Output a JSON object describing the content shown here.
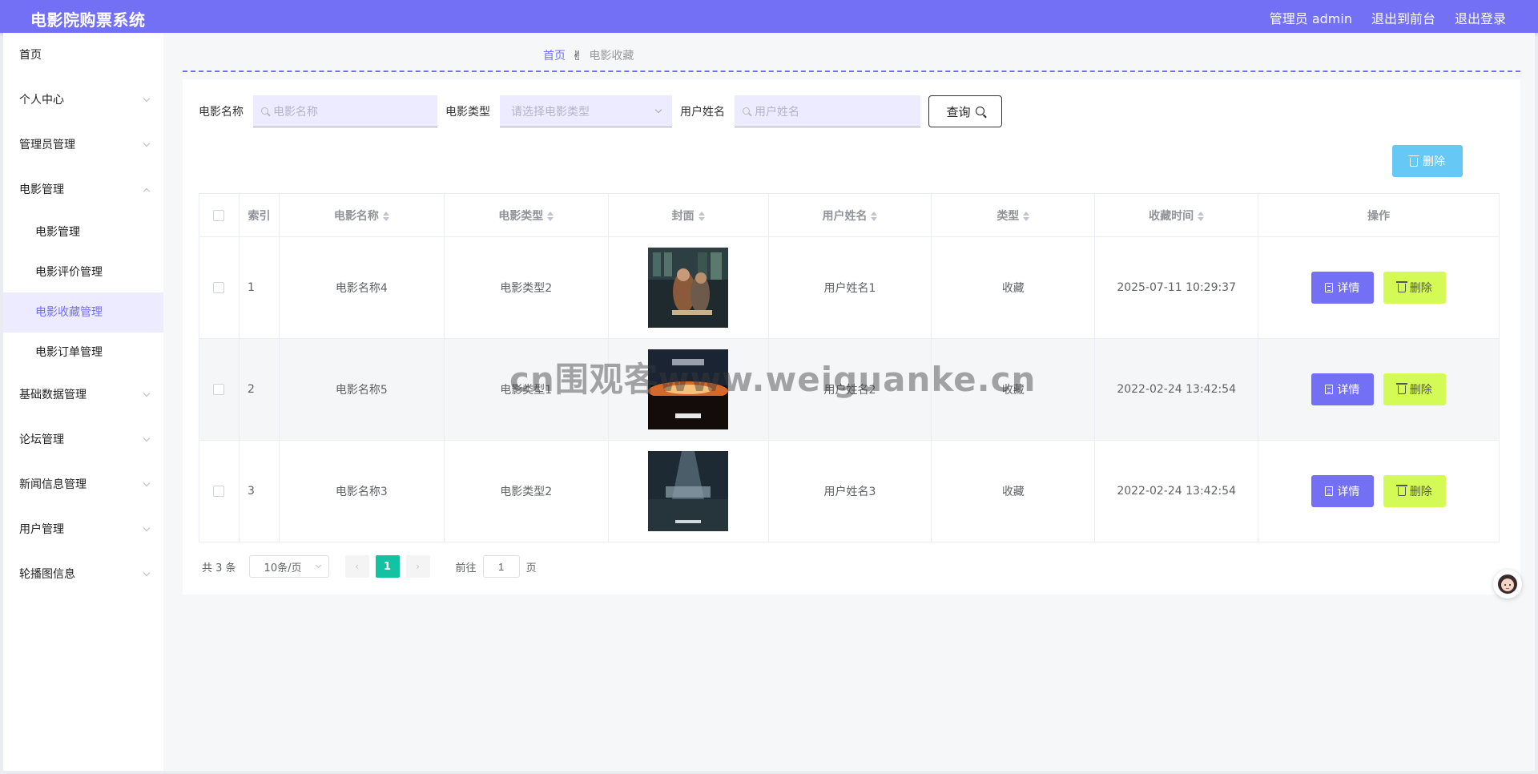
{
  "header": {
    "title": "电影院购票系统",
    "user_label": "管理员 admin",
    "to_front": "退出到前台",
    "logout": "退出登录"
  },
  "sidebar": {
    "items": [
      {
        "label": "首页"
      },
      {
        "label": "个人中心"
      },
      {
        "label": "管理员管理"
      },
      {
        "label": "电影管理"
      },
      {
        "label": "基础数据管理"
      },
      {
        "label": "论坛管理"
      },
      {
        "label": "新闻信息管理"
      },
      {
        "label": "用户管理"
      },
      {
        "label": "轮播图信息"
      }
    ],
    "sub_items": [
      {
        "label": "电影管理"
      },
      {
        "label": "电影评价管理"
      },
      {
        "label": "电影收藏管理"
      },
      {
        "label": "电影订单管理"
      }
    ]
  },
  "breadcrumb": {
    "home": "首页",
    "current": "电影收藏"
  },
  "search": {
    "movie_name_label": "电影名称",
    "movie_name_placeholder": "电影名称",
    "movie_type_label": "电影类型",
    "movie_type_placeholder": "请选择电影类型",
    "user_name_label": "用户姓名",
    "user_name_placeholder": "用户姓名",
    "query_label": "查询"
  },
  "toolbar": {
    "batch_delete_label": "删除"
  },
  "table": {
    "columns": [
      "索引",
      "电影名称",
      "电影类型",
      "封面",
      "用户姓名",
      "类型",
      "收藏时间",
      "操作"
    ],
    "rows": [
      {
        "index": "1",
        "movie_name": "电影名称4",
        "movie_type": "电影类型2",
        "user_name": "用户姓名1",
        "type": "收藏",
        "time": "2025-07-11 10:29:37"
      },
      {
        "index": "2",
        "movie_name": "电影名称5",
        "movie_type": "电影类型1",
        "user_name": "用户姓名2",
        "type": "收藏",
        "time": "2022-02-24 13:42:54"
      },
      {
        "index": "3",
        "movie_name": "电影名称3",
        "movie_type": "电影类型2",
        "user_name": "用户姓名3",
        "type": "收藏",
        "time": "2022-02-24 13:42:54"
      }
    ],
    "detail_label": "详情",
    "delete_label": "删除"
  },
  "pagination": {
    "total": "共 3 条",
    "page_size": "10条/页",
    "current_page": "1",
    "goto_prefix": "前往",
    "goto_value": "1",
    "goto_suffix": "页"
  },
  "watermark": "cn围观客www.weiguanke.cn",
  "colors": {
    "accent": "#7470f5",
    "detail_button": "#7470f5",
    "delete_button": "#d3fa55",
    "batch_delete": "#66c8f5",
    "page_active": "#13c2a3"
  }
}
